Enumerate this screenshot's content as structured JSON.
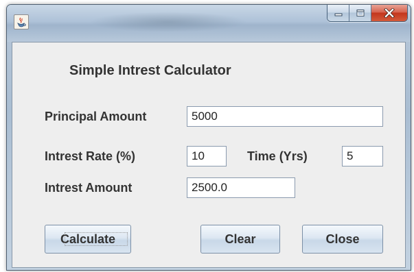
{
  "window": {
    "title": "",
    "icon": "java-cup-icon",
    "controls": {
      "minimize": "minimize-icon",
      "maximize": "maximize-icon",
      "close": "close-icon"
    },
    "close_color": "#c7432a"
  },
  "form": {
    "heading": "Simple Intrest Calculator",
    "principal_label": "Principal Amount",
    "principal_value": "5000",
    "rate_label": "Intrest Rate (%)",
    "rate_value": "10",
    "time_label": "Time (Yrs)",
    "time_value": "5",
    "interest_label": "Intrest Amount",
    "interest_value": "2500.0"
  },
  "buttons": {
    "calculate": "Calculate",
    "clear": "Clear",
    "close": "Close"
  }
}
